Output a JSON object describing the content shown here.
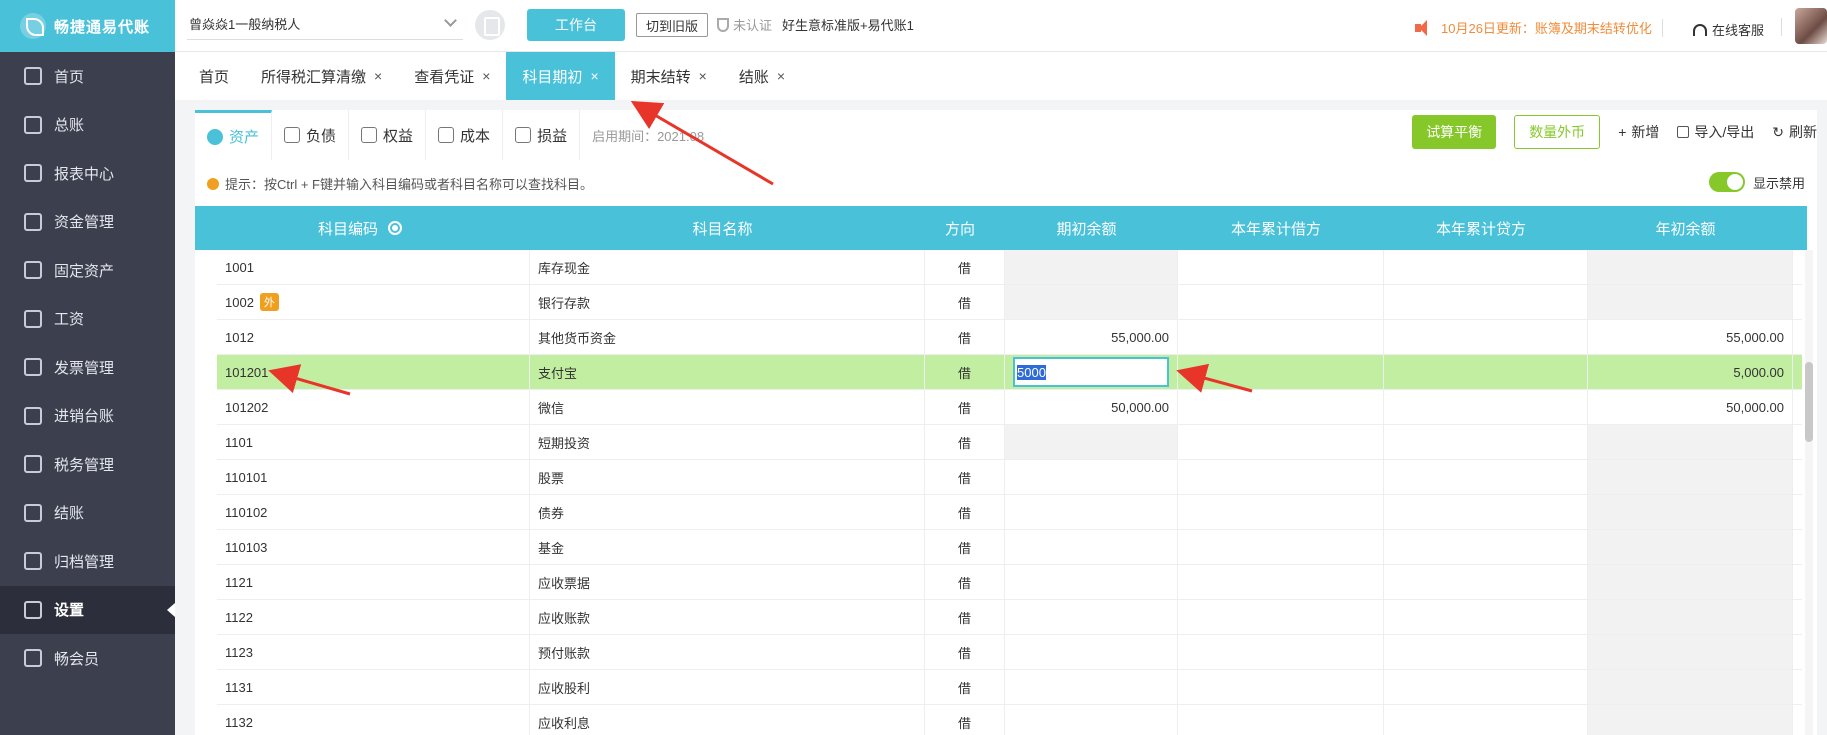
{
  "app": {
    "logo_text": "畅捷通易代账"
  },
  "sidebar": {
    "items": [
      {
        "label": "首页",
        "icon": "home-icon"
      },
      {
        "label": "总账",
        "icon": "ledger-icon"
      },
      {
        "label": "报表中心",
        "icon": "chart-icon"
      },
      {
        "label": "资金管理",
        "icon": "money-icon"
      },
      {
        "label": "固定资产",
        "icon": "asset-icon"
      },
      {
        "label": "工资",
        "icon": "salary-icon"
      },
      {
        "label": "发票管理",
        "icon": "invoice-icon"
      },
      {
        "label": "进销台账",
        "icon": "inventory-icon"
      },
      {
        "label": "税务管理",
        "icon": "tax-icon"
      },
      {
        "label": "结账",
        "icon": "close-books-icon"
      },
      {
        "label": "归档管理",
        "icon": "archive-icon"
      },
      {
        "label": "设置",
        "icon": "gear-icon"
      },
      {
        "label": "畅会员",
        "icon": "member-icon"
      }
    ],
    "active_index": 11
  },
  "topbar": {
    "company": "曾焱焱1一般纳税人",
    "workbench": "工作台",
    "switch_old": "切到旧版",
    "cert_status": "未认证",
    "product": "好生意标准版+易代账1",
    "notice": "10月26日更新：账簿及期末结转优化",
    "customer_service": "在线客服"
  },
  "tabs": [
    {
      "label": "首页",
      "closable": false
    },
    {
      "label": "所得税汇算清缴",
      "closable": true
    },
    {
      "label": "查看凭证",
      "closable": true
    },
    {
      "label": "科目期初",
      "closable": true,
      "active": true
    },
    {
      "label": "期末结转",
      "closable": true
    },
    {
      "label": "结账",
      "closable": true
    }
  ],
  "subtabs": [
    {
      "label": "资产",
      "active": true
    },
    {
      "label": "负债"
    },
    {
      "label": "权益"
    },
    {
      "label": "成本"
    },
    {
      "label": "损益"
    }
  ],
  "period": "启用期间：2021.08",
  "actions": {
    "trial_balance": "试算平衡",
    "quantity_fx": "数量外币",
    "add": "新增",
    "import_export": "导入/导出",
    "refresh": "刷新"
  },
  "hint": "提示：按Ctrl + F键并输入科目编码或者科目名称可以查找科目。",
  "show_disabled": "显示禁用",
  "table": {
    "headers": [
      "科目编码",
      "科目名称",
      "方向",
      "期初余额",
      "本年累计借方",
      "本年累计贷方",
      "年初余额"
    ],
    "rows": [
      {
        "code": "1001",
        "name": "库存现金",
        "dir": "借",
        "opening": "",
        "debit": "",
        "credit": "",
        "year_begin": "",
        "grey": true
      },
      {
        "code": "1002",
        "badge": "外",
        "name": "银行存款",
        "dir": "借",
        "opening": "",
        "debit": "",
        "credit": "",
        "year_begin": "",
        "grey": true
      },
      {
        "code": "1012",
        "name": "其他货币资金",
        "dir": "借",
        "opening": "55,000.00",
        "debit": "",
        "credit": "",
        "year_begin": "55,000.00",
        "grey": false
      },
      {
        "code": "101201",
        "name": "支付宝",
        "dir": "借",
        "opening": "5000",
        "debit": "",
        "credit": "",
        "year_begin": "5,000.00",
        "selected": true
      },
      {
        "code": "101202",
        "name": "微信",
        "dir": "借",
        "opening": "50,000.00",
        "debit": "",
        "credit": "",
        "year_begin": "50,000.00",
        "grey": false
      },
      {
        "code": "1101",
        "name": "短期投资",
        "dir": "借",
        "opening": "",
        "debit": "",
        "credit": "",
        "year_begin": "",
        "grey": true
      },
      {
        "code": "110101",
        "name": "股票",
        "dir": "借",
        "opening": "",
        "debit": "",
        "credit": "",
        "year_begin": "",
        "grey": false
      },
      {
        "code": "110102",
        "name": "债券",
        "dir": "借",
        "opening": "",
        "debit": "",
        "credit": "",
        "year_begin": "",
        "grey": false
      },
      {
        "code": "110103",
        "name": "基金",
        "dir": "借",
        "opening": "",
        "debit": "",
        "credit": "",
        "year_begin": "",
        "grey": false
      },
      {
        "code": "1121",
        "name": "应收票据",
        "dir": "借",
        "opening": "",
        "debit": "",
        "credit": "",
        "year_begin": "",
        "grey": false
      },
      {
        "code": "1122",
        "name": "应收账款",
        "dir": "借",
        "opening": "",
        "debit": "",
        "credit": "",
        "year_begin": "",
        "grey": false
      },
      {
        "code": "1123",
        "name": "预付账款",
        "dir": "借",
        "opening": "",
        "debit": "",
        "credit": "",
        "year_begin": "",
        "grey": false
      },
      {
        "code": "1131",
        "name": "应收股利",
        "dir": "借",
        "opening": "",
        "debit": "",
        "credit": "",
        "year_begin": "",
        "grey": false
      },
      {
        "code": "1132",
        "name": "应收利息",
        "dir": "借",
        "opening": "",
        "debit": "",
        "credit": "",
        "year_begin": "",
        "grey": false
      }
    ]
  },
  "colors": {
    "accent": "#49c1d9",
    "green": "#86c82a",
    "sidebar": "#3b3f4e",
    "annotation": "#e8352a"
  }
}
